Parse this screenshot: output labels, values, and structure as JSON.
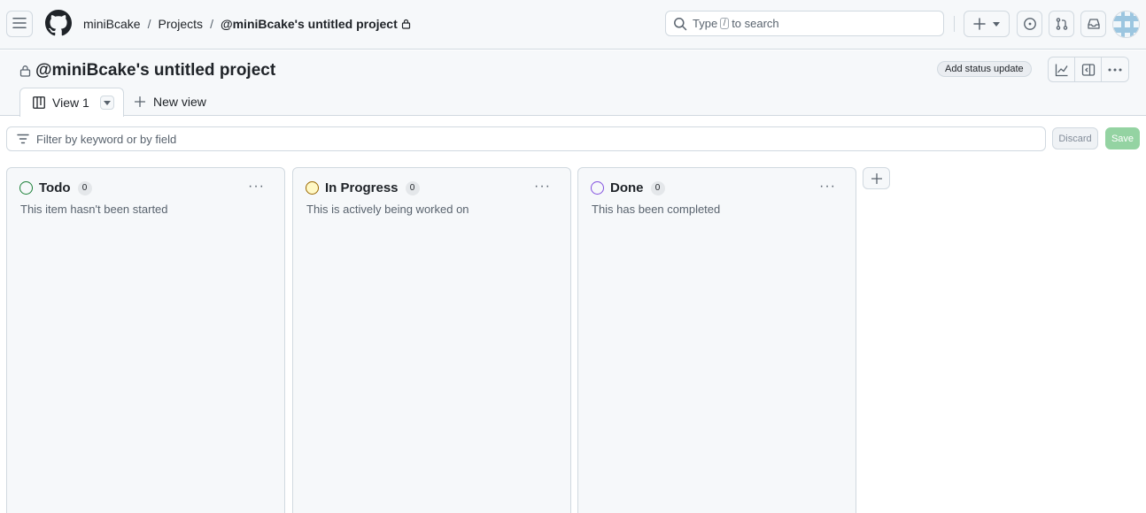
{
  "header": {
    "breadcrumbs": [
      "miniBcake",
      "Projects",
      "@miniBcake's untitled project"
    ],
    "search": {
      "before": "Type",
      "key": "/",
      "after": "to search"
    }
  },
  "project": {
    "title": "@miniBcake's untitled project",
    "status_update_label": "Add status update",
    "tabs": [
      {
        "label": "View 1"
      }
    ],
    "new_view_label": "New view"
  },
  "filter": {
    "placeholder": "Filter by keyword or by field",
    "discard_label": "Discard",
    "save_label": "Save"
  },
  "board": {
    "columns": [
      {
        "name": "Todo",
        "count": "0",
        "description": "This item hasn't been started",
        "color": "#1a7f37"
      },
      {
        "name": "In Progress",
        "count": "0",
        "description": "This is actively being worked on",
        "color": "#9a6700"
      },
      {
        "name": "Done",
        "count": "0",
        "description": "This has been completed",
        "color": "#8250df"
      }
    ]
  },
  "icons": [
    "hamburger-icon",
    "github-logo-icon",
    "lock-icon",
    "search-icon",
    "plus-icon",
    "chevron-down-icon",
    "issue-icon",
    "pull-request-icon",
    "inbox-icon",
    "insights-icon",
    "sidebar-icon",
    "kebab-icon",
    "board-icon",
    "filter-icon"
  ]
}
